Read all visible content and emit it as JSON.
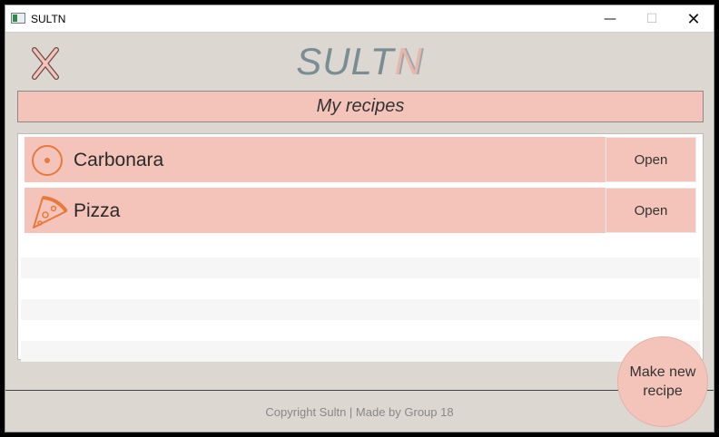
{
  "window": {
    "title": "SULTN",
    "controls": {
      "minimize": "—",
      "maximize": "☐",
      "close": "✕"
    }
  },
  "app": {
    "logo_main": "SULT",
    "logo_accent": "N",
    "close_icon": "close-x-icon"
  },
  "header": {
    "title": "My recipes"
  },
  "recipes": [
    {
      "name": "Carbonara",
      "icon": "plate-icon",
      "open_label": "Open"
    },
    {
      "name": "Pizza",
      "icon": "pizza-icon",
      "open_label": "Open"
    }
  ],
  "fab": {
    "label": "Make new recipe"
  },
  "footer": {
    "text": "Copyright Sultn | Made by Group 18"
  },
  "colors": {
    "background": "#dcd7d0",
    "accent": "#f4c4bb",
    "logo": "#7a8c94",
    "icon_orange": "#e8793a"
  }
}
